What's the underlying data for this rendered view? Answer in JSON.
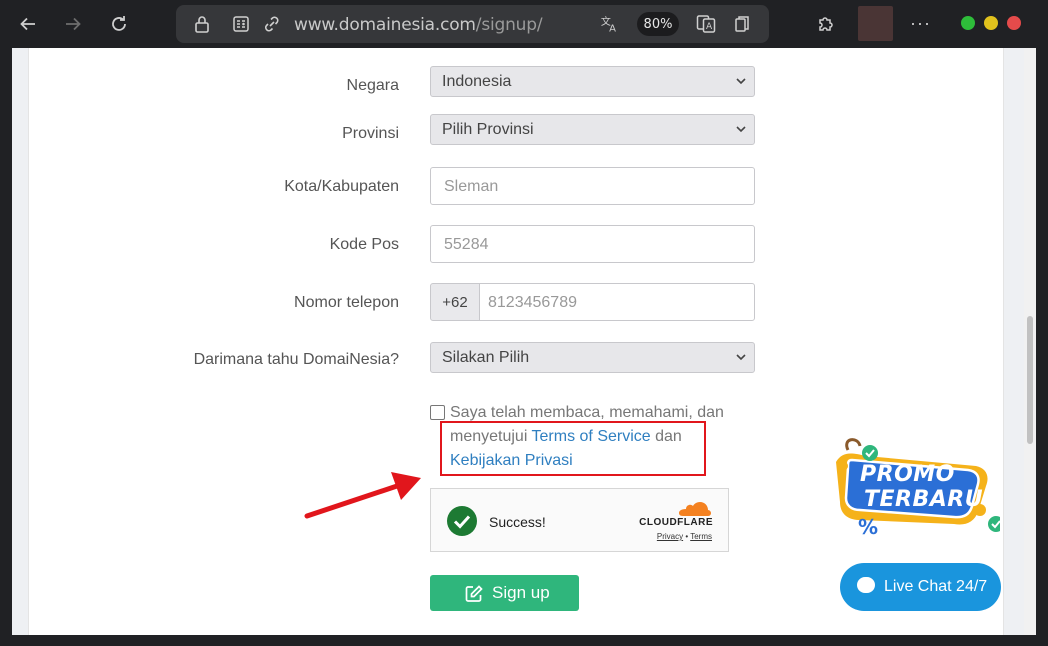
{
  "browser": {
    "url_domain": "www.domainesia.com",
    "url_path": "/signup/",
    "zoom": "80%"
  },
  "form": {
    "negara": {
      "label": "Negara",
      "value": "Indonesia"
    },
    "provinsi": {
      "label": "Provinsi",
      "value": "Pilih Provinsi"
    },
    "kota": {
      "label": "Kota/Kabupaten",
      "placeholder": "Sleman"
    },
    "kodepos": {
      "label": "Kode Pos",
      "placeholder": "55284"
    },
    "telepon": {
      "label": "Nomor telepon",
      "prefix": "+62",
      "placeholder": "8123456789"
    },
    "darimana": {
      "label": "Darimana tahu DomaiNesia?",
      "value": "Silakan Pilih"
    },
    "agree": {
      "text_before": "Saya telah membaca, memahami, dan menyetujui",
      "terms_link": "Terms of Service",
      "text_mid": "dan",
      "privacy_link": "Kebijakan Privasi"
    },
    "captcha": {
      "status": "Success!",
      "brand": "CLOUDFLARE",
      "privacy": "Privacy",
      "sep": "•",
      "terms": "Terms"
    },
    "submit_label": "Sign up"
  },
  "promo": {
    "line1": "PROMO",
    "line2": "TERBARU"
  },
  "livechat": {
    "label": "Live Chat 24/7"
  },
  "colors": {
    "accent_green": "#2fb67c",
    "link_blue": "#2f7fc0",
    "annotation_red": "#e1161c",
    "livechat_blue": "#1a95dd"
  }
}
